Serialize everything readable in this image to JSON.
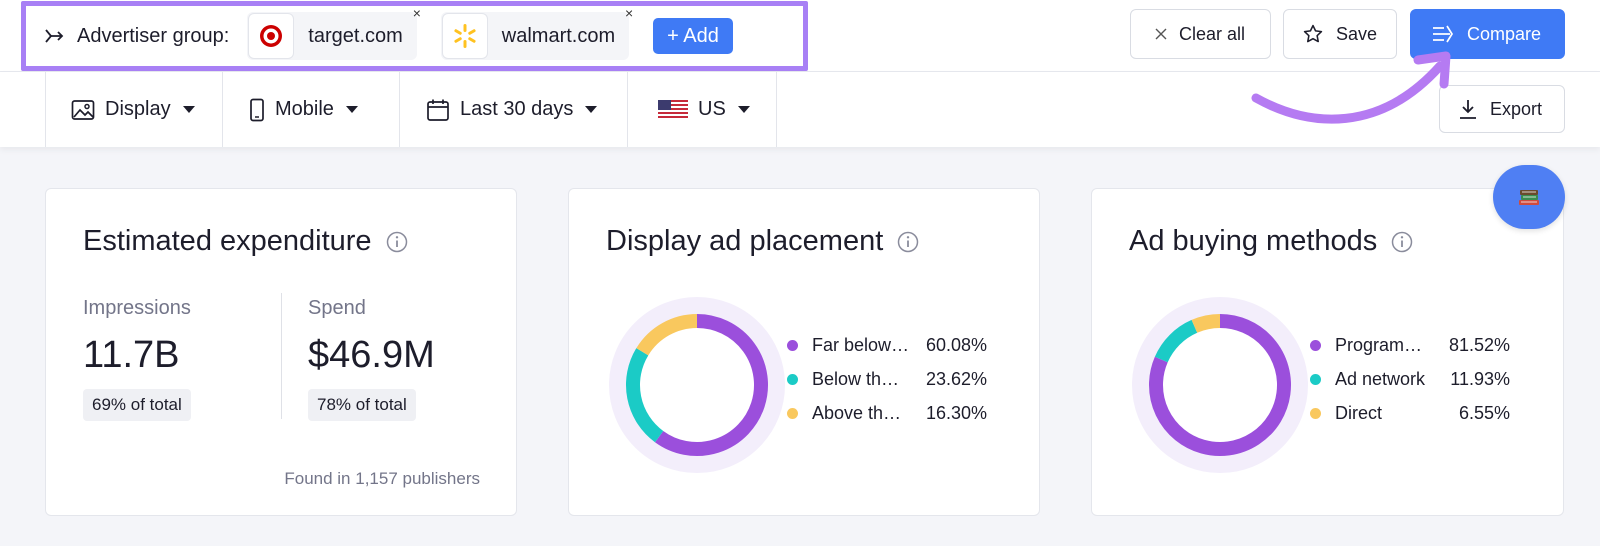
{
  "top": {
    "advertiser_label": "Advertiser group:",
    "chips": [
      {
        "domain": "target.com",
        "logo_icon": "target-logo",
        "close": "×"
      },
      {
        "domain": "walmart.com",
        "logo_icon": "walmart-spark-logo",
        "close": "×"
      }
    ],
    "add_label": "+ Add",
    "clear_label": "Clear all",
    "save_label": "Save",
    "compare_label": "Compare",
    "highlight_color": "#a880f5",
    "accent_color": "#3f7af5"
  },
  "filters": {
    "display": "Display",
    "device": "Mobile",
    "period": "Last 30 days",
    "country": "US",
    "export_label": "Export"
  },
  "expenditure": {
    "title": "Estimated expenditure",
    "impressions_label": "Impressions",
    "impressions_value": "11.7B",
    "impressions_badge": "69% of total",
    "spend_label": "Spend",
    "spend_value": "$46.9M",
    "spend_badge": "78% of total",
    "found_text": "Found in 1,157 publishers"
  },
  "placement": {
    "title": "Display ad placement",
    "items": [
      {
        "label": "Far below…",
        "pct": "60.08%",
        "value": 60.08,
        "color": "#9b4fdc"
      },
      {
        "label": "Below th…",
        "pct": "23.62%",
        "value": 23.62,
        "color": "#1bcbc6"
      },
      {
        "label": "Above th…",
        "pct": "16.30%",
        "value": 16.3,
        "color": "#f9c85e"
      }
    ]
  },
  "buying": {
    "title": "Ad buying methods",
    "items": [
      {
        "label": "Program…",
        "pct": "81.52%",
        "value": 81.52,
        "color": "#9b4fdc"
      },
      {
        "label": "Ad network",
        "pct": "11.93%",
        "value": 11.93,
        "color": "#1bcbc6"
      },
      {
        "label": "Direct",
        "pct": "6.55%",
        "value": 6.55,
        "color": "#f9c85e"
      }
    ]
  }
}
